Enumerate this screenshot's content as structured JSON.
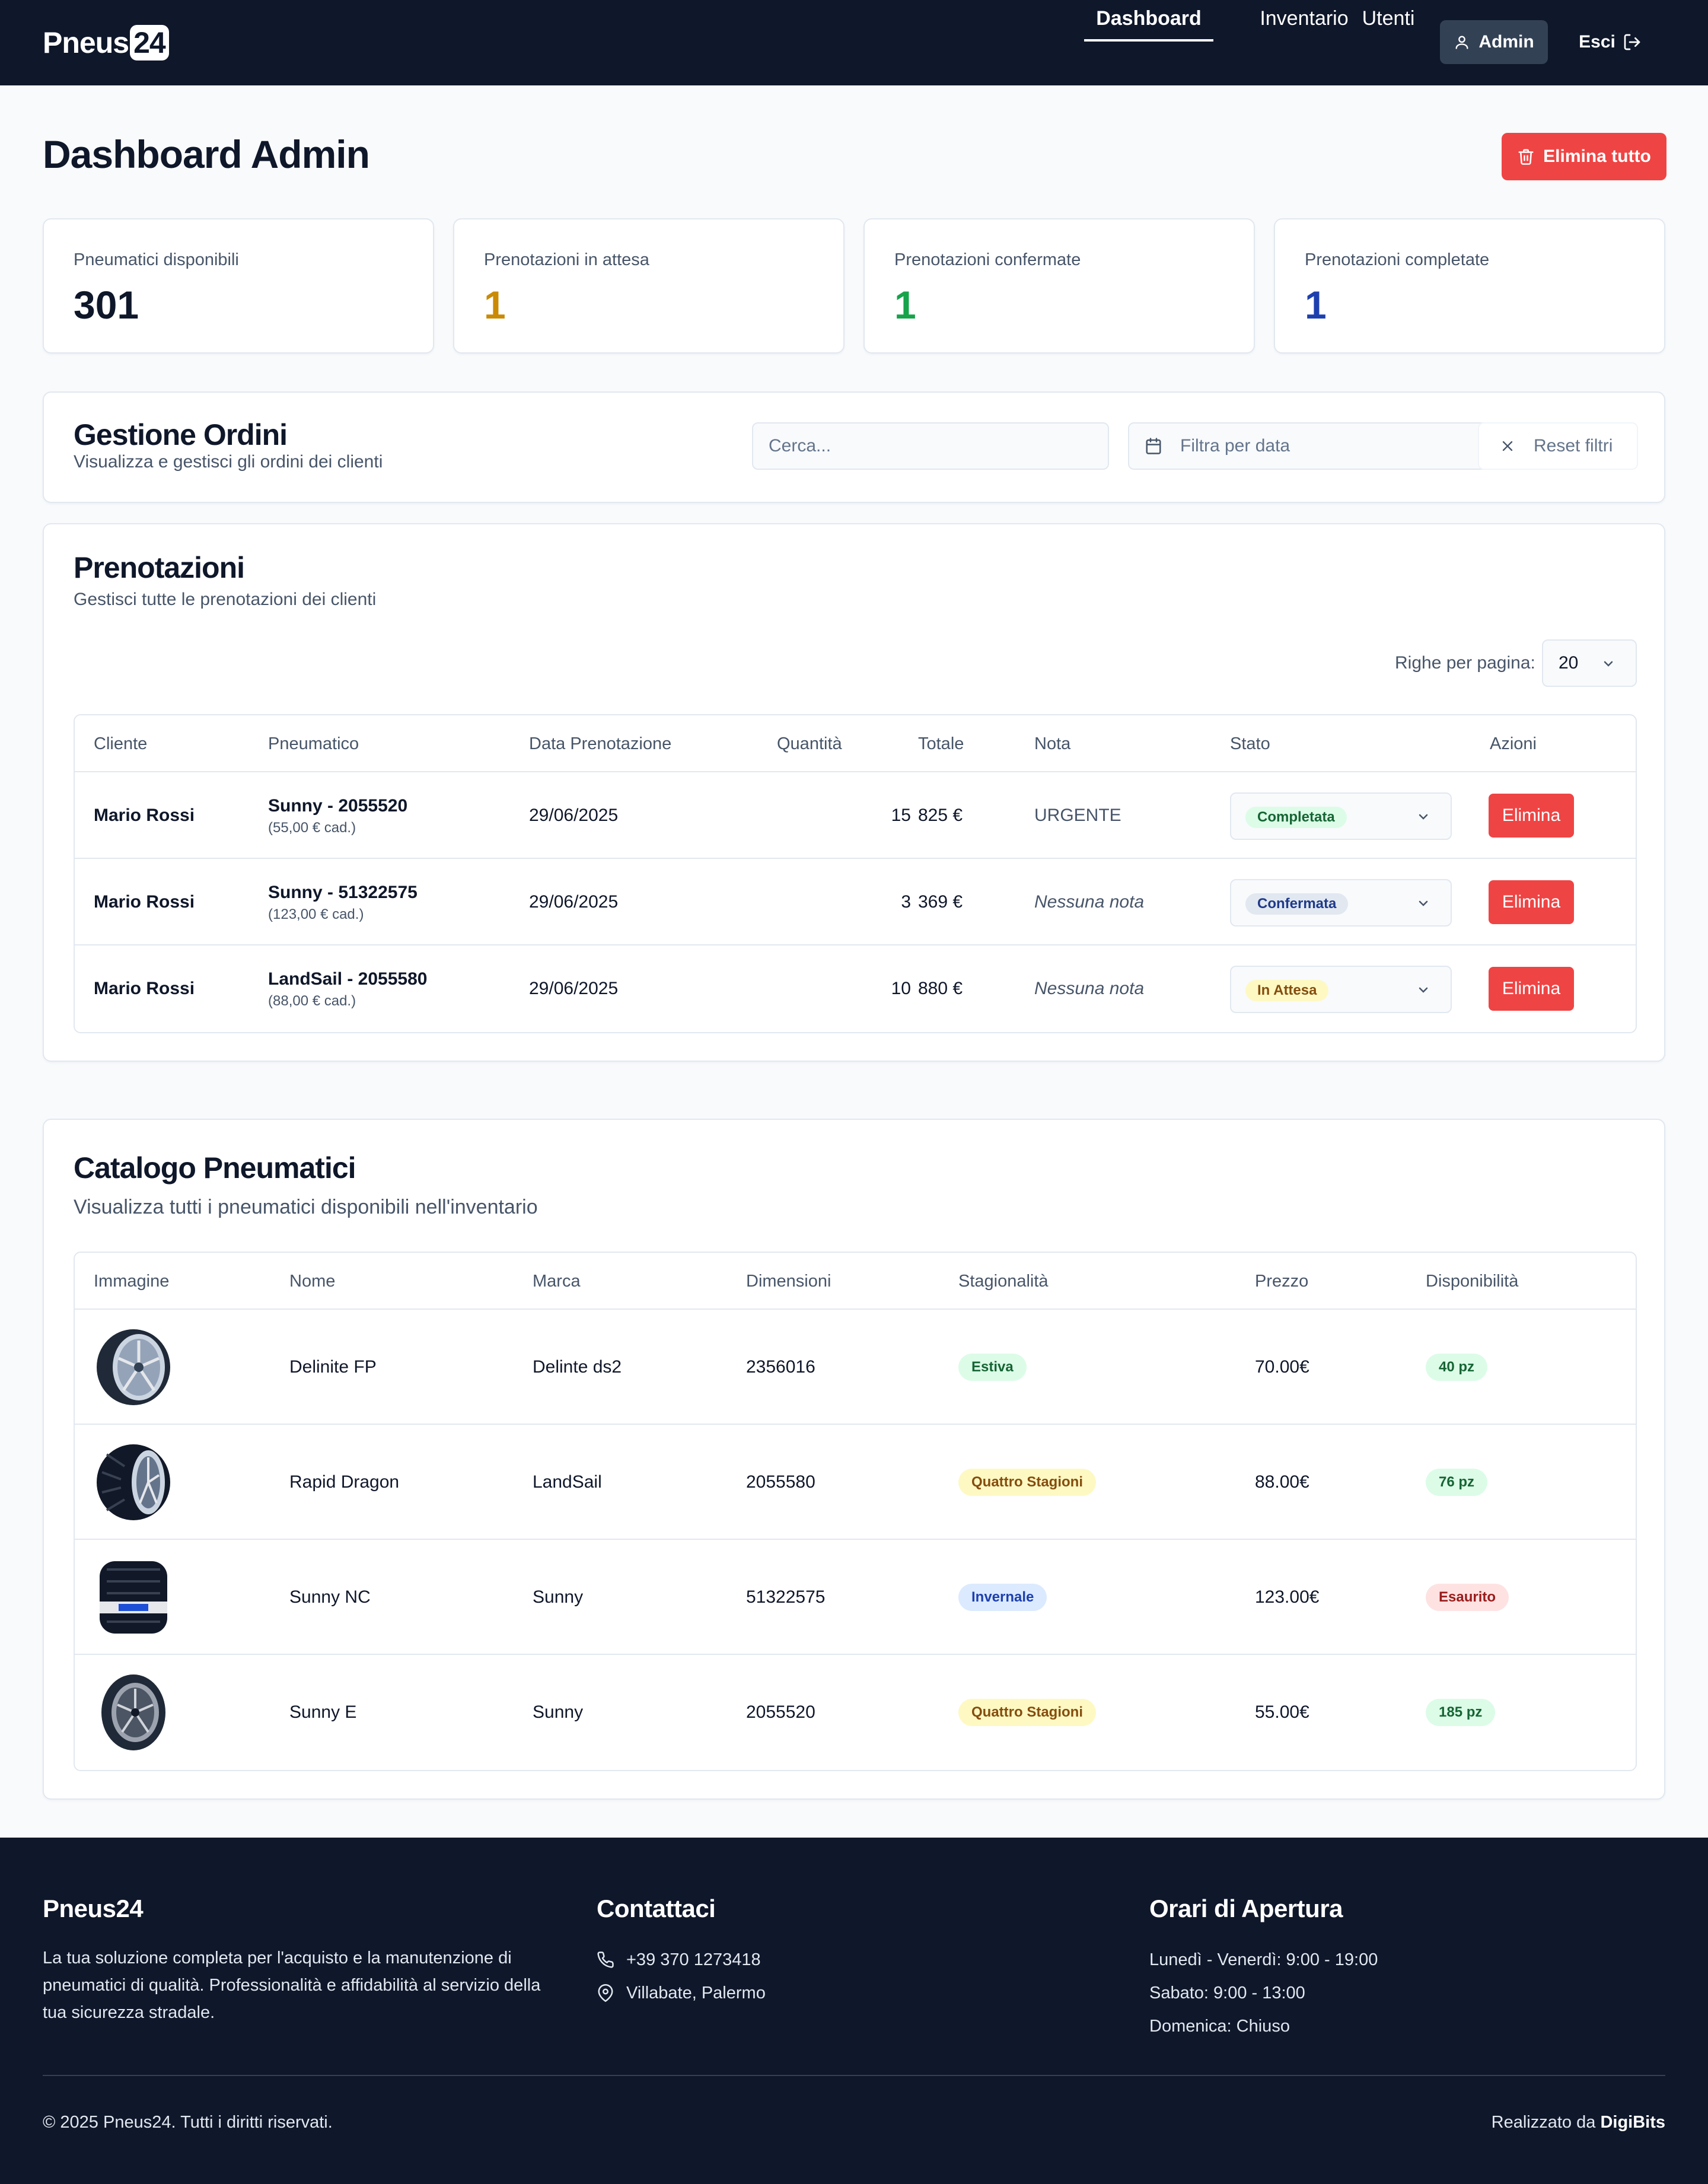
{
  "colors": {
    "navy": "#0f172a",
    "danger": "#ef4444",
    "amber": "#ca8a04",
    "green": "#16a34a",
    "blue": "#1e40af"
  },
  "navbar": {
    "brand_text": "Pneus",
    "brand_box": "24",
    "links": [
      "Dashboard",
      "Inventario",
      "Utenti"
    ],
    "admin_label": "Admin",
    "admin_icon": "user-icon",
    "exit_label": "Esci",
    "exit_icon": "logout-icon"
  },
  "header": {
    "title": "Dashboard Admin",
    "delete_all_label": "Elimina tutto",
    "delete_all_icon": "trash-icon"
  },
  "stats": [
    {
      "label": "Pneumatici disponibili",
      "value": "301",
      "color": "#0f172a"
    },
    {
      "label": "Prenotazioni in attesa",
      "value": "1",
      "color": "#ca8a04"
    },
    {
      "label": "Prenotazioni confermate",
      "value": "1",
      "color": "#16a34a"
    },
    {
      "label": "Prenotazioni completate",
      "value": "1",
      "color": "#1e40af"
    }
  ],
  "orders": {
    "title": "Gestione Ordini",
    "subtitle": "Visualizza e gestisci gli ordini dei clienti",
    "search_placeholder": "Cerca...",
    "date_placeholder": "Filtra per data",
    "reset_label": "Reset filtri"
  },
  "bookings": {
    "title": "Prenotazioni",
    "subtitle": "Gestisci tutte le prenotazioni dei clienti",
    "rows_label": "Righe per pagina:",
    "rows_value": "20",
    "columns": [
      "Cliente",
      "Pneumatico",
      "Data Prenotazione",
      "Quantità",
      "Totale",
      "Nota",
      "Stato",
      "Azioni"
    ],
    "rows": [
      {
        "cliente": "Mario Rossi",
        "pneumatico": "Sunny - 2055520",
        "prezzo_unit": "(55,00 € cad.)",
        "data": "29/06/2025",
        "quantita": "15",
        "totale": "825 €",
        "nota": "URGENTE",
        "nota_empty": false,
        "stato": "Completata",
        "stato_bg": "#dcfce7",
        "stato_fg": "#166534",
        "azione": "Elimina"
      },
      {
        "cliente": "Mario Rossi",
        "pneumatico": "Sunny - 51322575",
        "prezzo_unit": "(123,00 € cad.)",
        "data": "29/06/2025",
        "quantita": "3",
        "totale": "369 €",
        "nota": "Nessuna nota",
        "nota_empty": true,
        "stato": "Confermata",
        "stato_bg": "#e2e8f0",
        "stato_fg": "#1e3a8a",
        "azione": "Elimina"
      },
      {
        "cliente": "Mario Rossi",
        "pneumatico": "LandSail - 2055580",
        "prezzo_unit": "(88,00 € cad.)",
        "data": "29/06/2025",
        "quantita": "10",
        "totale": "880 €",
        "nota": "Nessuna nota",
        "nota_empty": true,
        "stato": "In Attesa",
        "stato_bg": "#fef9c3",
        "stato_fg": "#854d0e",
        "azione": "Elimina"
      }
    ]
  },
  "catalog": {
    "title": "Catalogo Pneumatici",
    "subtitle": "Visualizza tutti i pneumatici disponibili nell'inventario",
    "columns": [
      "Immagine",
      "Nome",
      "Marca",
      "Dimensioni",
      "Stagionalità",
      "Prezzo",
      "Disponibilità"
    ],
    "rows": [
      {
        "image": "summer-tire-icon",
        "nome": "Delinite FP",
        "marca": "Delinte ds2",
        "dimensioni": "2356016",
        "stagione": "Estiva",
        "stagione_bg": "#dcfce7",
        "stagione_fg": "#166534",
        "prezzo": "70.00€",
        "disp": "40 pz",
        "disp_bg": "#dcfce7",
        "disp_fg": "#166534"
      },
      {
        "image": "all-season-tire-icon",
        "nome": "Rapid Dragon",
        "marca": "LandSail",
        "dimensioni": "2055580",
        "stagione": "Quattro Stagioni",
        "stagione_bg": "#fef9c3",
        "stagione_fg": "#854d0e",
        "prezzo": "88.00€",
        "disp": "76 pz",
        "disp_bg": "#dcfce7",
        "disp_fg": "#166534"
      },
      {
        "image": "winter-tire-icon",
        "nome": "Sunny NC",
        "marca": "Sunny",
        "dimensioni": "51322575",
        "stagione": "Invernale",
        "stagione_bg": "#dbeafe",
        "stagione_fg": "#1e40af",
        "prezzo": "123.00€",
        "disp": "Esaurito",
        "disp_bg": "#fee2e2",
        "disp_fg": "#991b1b"
      },
      {
        "image": "tire-icon",
        "nome": "Sunny E",
        "marca": "Sunny",
        "dimensioni": "2055520",
        "stagione": "Quattro Stagioni",
        "stagione_bg": "#fef9c3",
        "stagione_fg": "#854d0e",
        "prezzo": "55.00€",
        "disp": "185 pz",
        "disp_bg": "#dcfce7",
        "disp_fg": "#166534"
      }
    ]
  },
  "footer": {
    "brand": "Pneus24",
    "description": "La tua soluzione completa per l'acquisto e la manutenzione di pneumatici di qualità. Professionalità e affidabilità al servizio della tua sicurezza stradale.",
    "contact_title": "Contattaci",
    "phone": "+39 370 1273418",
    "address": "Villabate, Palermo",
    "hours_title": "Orari di Apertura",
    "hours": [
      "Lunedì - Venerdì: 9:00 - 19:00",
      "Sabato: 9:00 - 13:00",
      "Domenica: Chiuso"
    ],
    "copyright": "© 2025 Pneus24. Tutti i diritti riservati.",
    "credit_prefix": "Realizzato da",
    "credit_name": "DigiBits"
  }
}
